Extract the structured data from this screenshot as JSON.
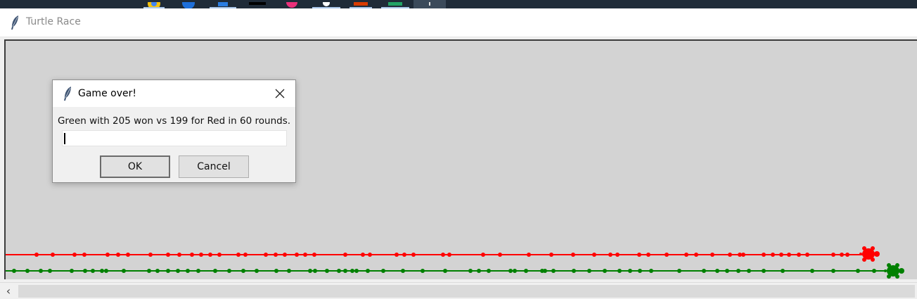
{
  "window": {
    "title": "Turtle Race"
  },
  "dialog": {
    "title": "Game over!",
    "message": "Green with 205 won vs 199 for Red in 60 rounds.",
    "input_value": "",
    "ok_label": "OK",
    "cancel_label": "Cancel",
    "close_icon": "close-icon"
  },
  "scrollbar": {
    "left_arrow": "‹"
  },
  "race": {
    "red": {
      "color": "#ff0000",
      "score": 199,
      "dots": [
        44,
        67,
        98,
        112,
        145,
        160,
        174,
        206,
        231,
        247,
        265,
        278,
        291,
        304,
        331,
        341,
        370,
        384,
        397,
        414,
        426,
        439,
        483,
        508,
        518,
        556,
        567,
        580,
        622,
        631,
        679,
        703,
        744,
        776,
        807,
        837,
        860,
        870,
        901,
        914,
        940,
        968,
        982,
        1005,
        1030,
        1044,
        1049,
        1078,
        1091,
        1103,
        1114,
        1128,
        1140,
        1177,
        1189,
        1197
      ]
    },
    "green": {
      "color": "#008000",
      "score": 205,
      "dots": [
        12,
        31,
        50,
        63,
        94,
        113,
        124,
        137,
        143,
        168,
        204,
        216,
        231,
        245,
        259,
        274,
        298,
        318,
        338,
        357,
        385,
        403,
        433,
        440,
        457,
        474,
        483,
        493,
        499,
        515,
        537,
        565,
        593,
        625,
        661,
        673,
        687,
        718,
        724,
        740,
        763,
        767,
        779,
        808,
        830,
        852,
        873,
        888,
        902,
        918,
        958,
        993,
        1012,
        1026,
        1042,
        1057,
        1078,
        1105,
        1147,
        1177,
        1212,
        1235
      ]
    }
  }
}
